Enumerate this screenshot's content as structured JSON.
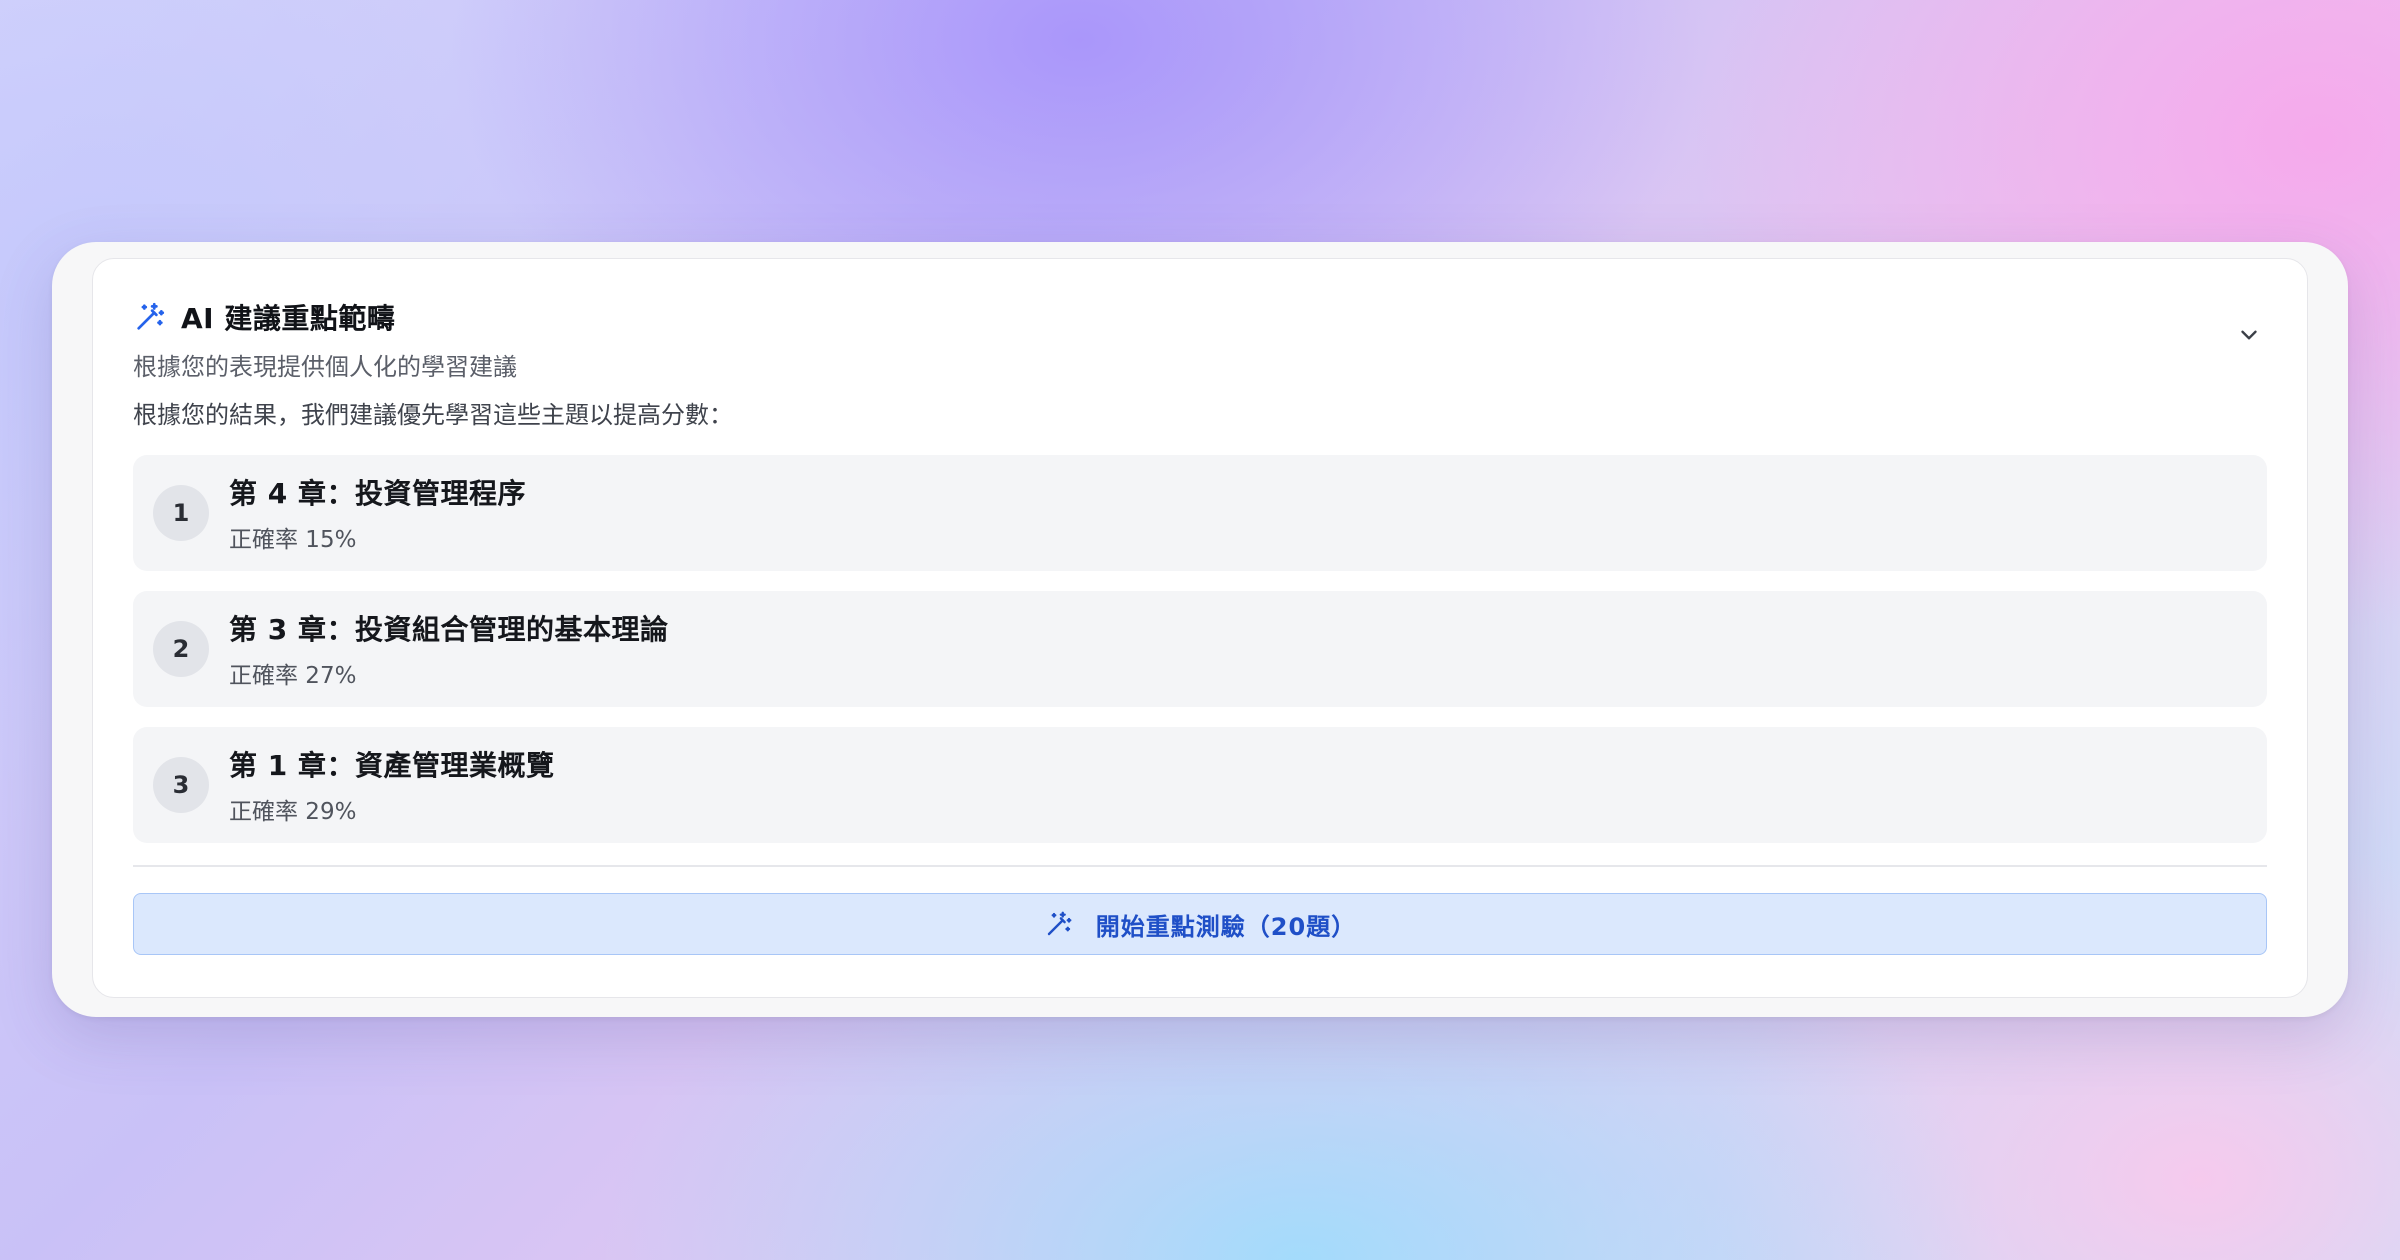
{
  "panel": {
    "title": "AI 建議重點範疇",
    "subtitle": "根據您的表現提供個人化的學習建議",
    "title_icon": "magic-wand-icon",
    "toggle_icon": "chevron-down-icon"
  },
  "intro": "根據您的結果，我們建議優先學習這些主題以提高分數：",
  "topics": [
    {
      "rank": "1",
      "title": "第 4 章：投資管理程序",
      "rate": "正確率 15%"
    },
    {
      "rank": "2",
      "title": "第 3 章：投資組合管理的基本理論",
      "rate": "正確率 27%"
    },
    {
      "rank": "3",
      "title": "第 1 章：資產管理業概覽",
      "rate": "正確率 29%"
    }
  ],
  "start_button": {
    "label": "開始重點測驗（20題）",
    "icon": "magic-wand-icon"
  },
  "colors": {
    "accent": "#1f4fc7",
    "button_bg": "#dbe8fd",
    "item_bg": "#f4f5f7"
  }
}
